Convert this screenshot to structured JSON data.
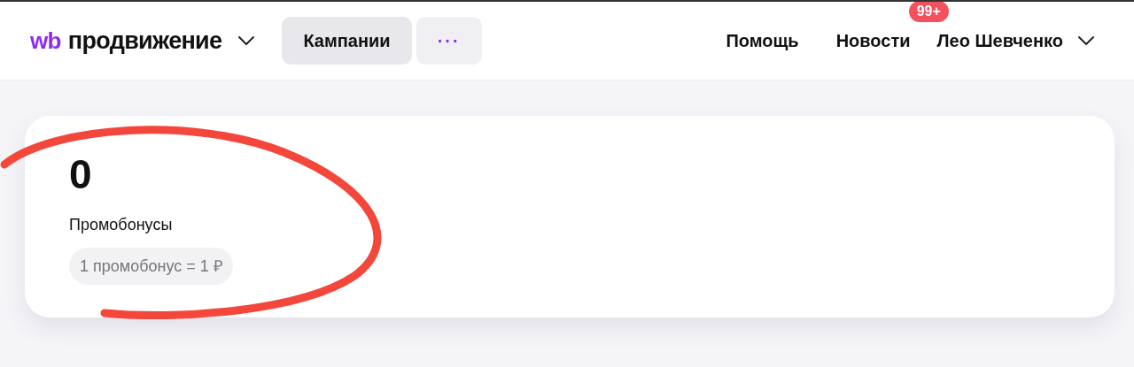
{
  "header": {
    "logo_mark": "wb",
    "logo_text": "продвижение",
    "tabs": [
      {
        "label": "Кампании",
        "selected": true
      },
      {
        "label": "···",
        "selected": false
      }
    ],
    "links": [
      {
        "label": "Помощь"
      },
      {
        "label": "Новости",
        "badge": "99+"
      }
    ],
    "user": "Лео Шевченко"
  },
  "card": {
    "value": "0",
    "label": "Промобонусы",
    "rate": "1 промобонус = 1 ₽"
  }
}
